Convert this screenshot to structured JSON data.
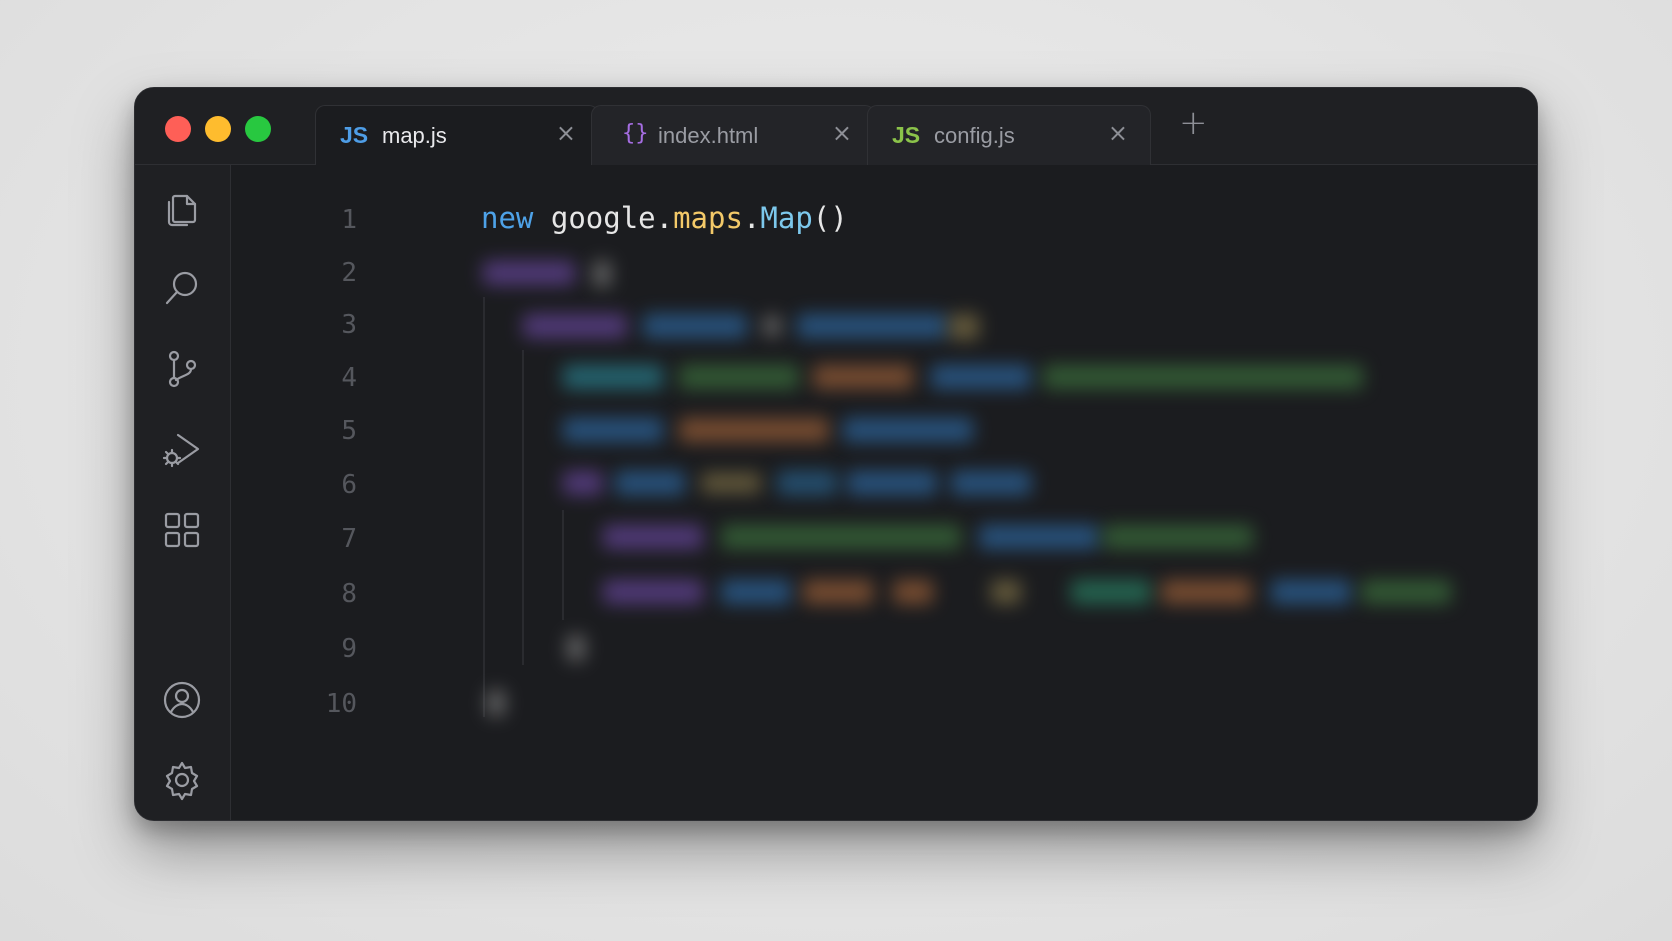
{
  "window": {
    "traffic_lights": [
      "close",
      "minimize",
      "maximize"
    ]
  },
  "tabs": [
    {
      "icon": "JS",
      "label": "map.js",
      "active": true,
      "icon_color": "#4e9de6"
    },
    {
      "icon": "{}",
      "label": "index.html",
      "active": false,
      "icon_color": "#a56de2"
    },
    {
      "icon": "JS",
      "label": "config.js",
      "active": false,
      "icon_color": "#8bc34a"
    }
  ],
  "tab_close_glyph": "×",
  "tab_add_glyph": "+",
  "sidebar": {
    "items": [
      {
        "icon": "files-icon"
      },
      {
        "icon": "search-icon"
      },
      {
        "icon": "source-control-icon"
      },
      {
        "icon": "run-debug-icon"
      },
      {
        "icon": "extensions-icon"
      },
      {
        "icon": "account-icon"
      },
      {
        "icon": "settings-icon"
      }
    ]
  },
  "editor": {
    "line_numbers": [
      "1",
      "2",
      "3",
      "4",
      "5",
      "6",
      "7",
      "8",
      "9",
      "10"
    ],
    "line1": {
      "kw": "new",
      "obj": "google",
      "dot1": ".",
      "prop": "maps",
      "dot2": ".",
      "fn": "Map",
      "parens": "()"
    },
    "blurred_lines": 9
  },
  "colors": {
    "background": "#e4e4e4",
    "window": "#1b1c1f",
    "keyword": "#4ea2e8",
    "property": "#f3c969",
    "function": "#7dc8ec"
  }
}
